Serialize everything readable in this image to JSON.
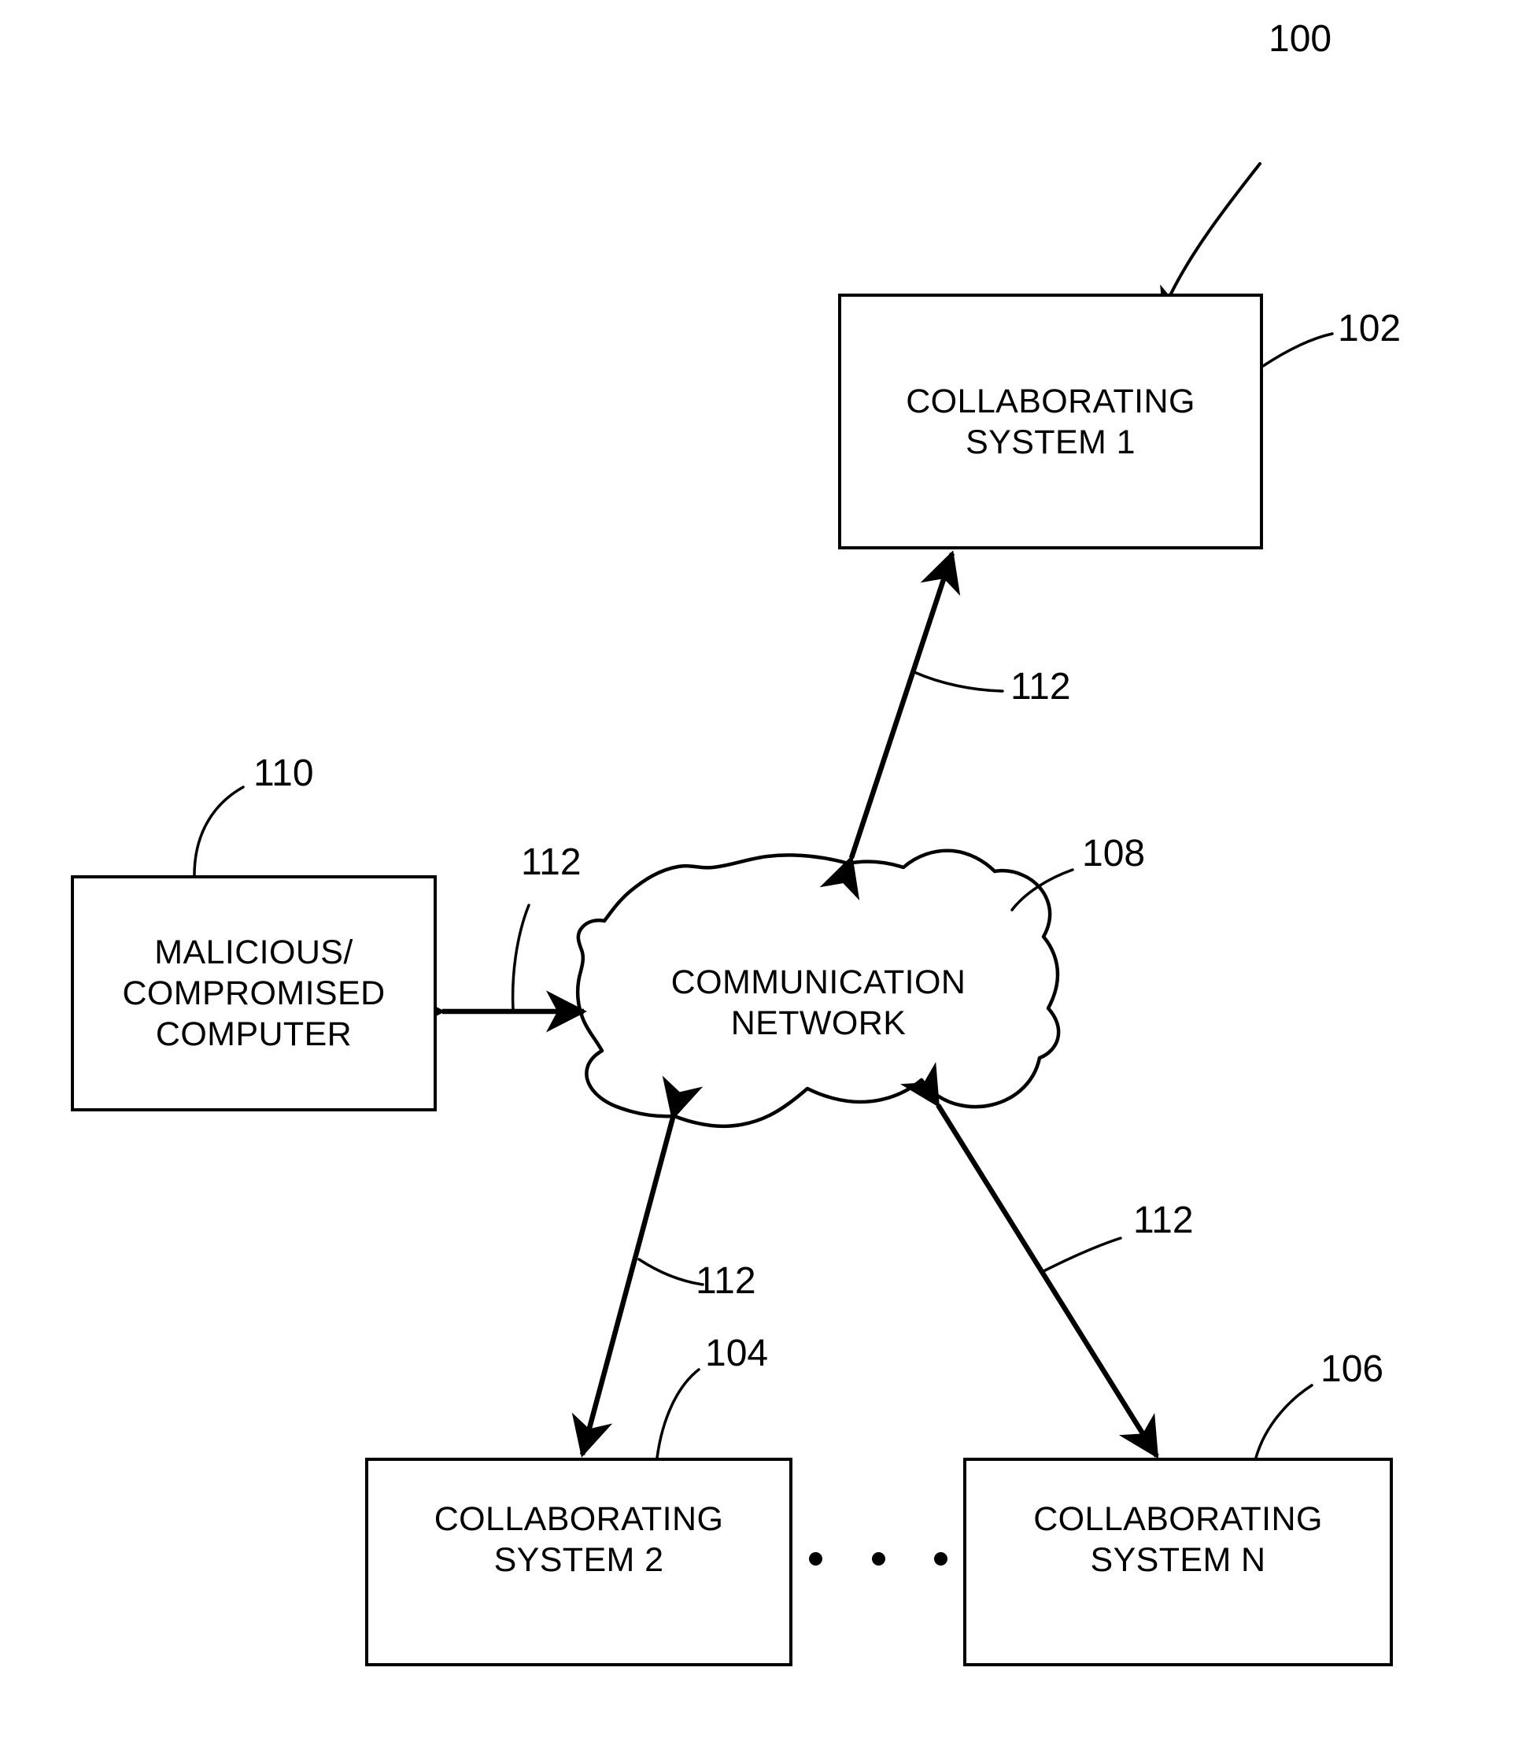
{
  "figure": {
    "figure_number": "100",
    "background_color": "#ffffff",
    "line_color": "#000000"
  },
  "nodes": {
    "system_1": {
      "label": "COLLABORATING\nSYSTEM 1",
      "ref": "102"
    },
    "system_2": {
      "label": "COLLABORATING\nSYSTEM 2",
      "ref": "104"
    },
    "system_n": {
      "label": "COLLABORATING\nSYSTEM N",
      "ref": "106"
    },
    "network": {
      "label": "COMMUNICATION\nNETWORK",
      "ref": "108"
    },
    "malicious_computer": {
      "label": "MALICIOUS/\nCOMPROMISED\nCOMPUTER",
      "ref": "110"
    }
  },
  "links": {
    "network_to_system_1": {
      "ref": "112"
    },
    "network_to_malicious": {
      "ref": "112"
    },
    "network_to_system_2": {
      "ref": "112"
    },
    "network_to_system_n": {
      "ref": "112"
    }
  },
  "ellipsis": {
    "dot_count": 3,
    "meaning": "additional-collaborating-systems"
  }
}
